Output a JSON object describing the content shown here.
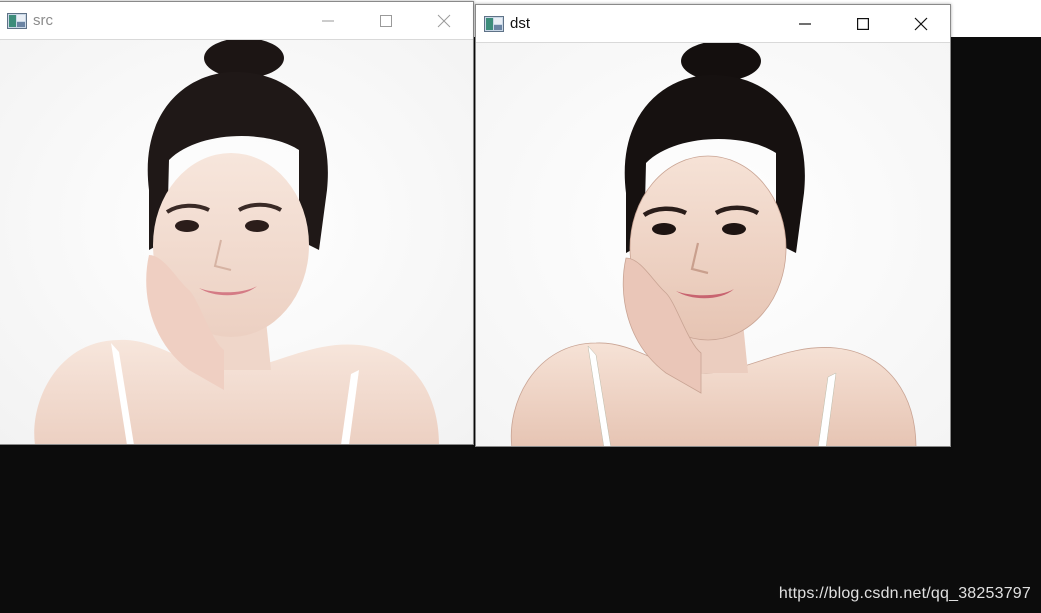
{
  "windows": [
    {
      "id": "src",
      "title": "src",
      "title_color": "#8c8c8c",
      "icon": "app-icon",
      "controls": [
        "minimize-icon",
        "maximize-icon",
        "close-icon"
      ]
    },
    {
      "id": "dst",
      "title": "dst",
      "title_color": "#111111",
      "icon": "app-icon",
      "controls": [
        "minimize-icon",
        "maximize-icon",
        "close-icon"
      ]
    }
  ],
  "watermark": {
    "text": "https://blog.csdn.net/qq_38253797"
  },
  "colors": {
    "desktop_bg": "#0c0c0c",
    "window_bg": "#ffffff"
  }
}
